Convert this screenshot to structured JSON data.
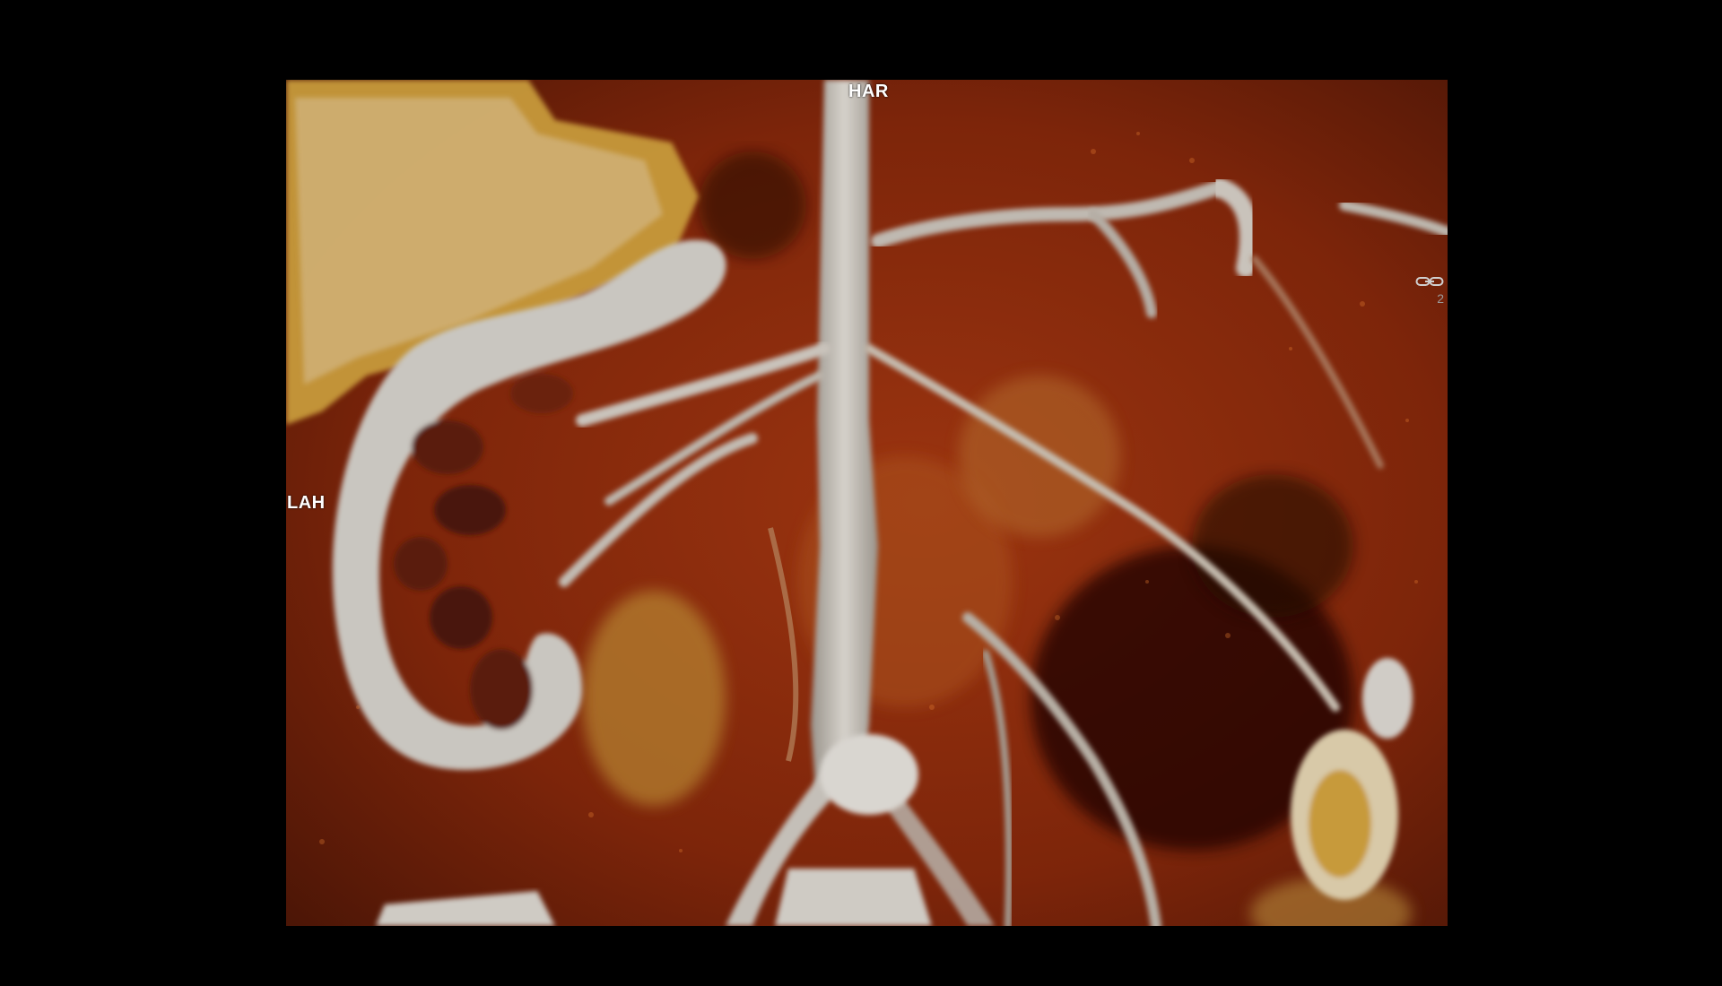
{
  "viewer": {
    "orientation": {
      "top": "HAR",
      "left": "LAH"
    },
    "link_control": {
      "icon": "link-icon",
      "value": "2"
    }
  },
  "colors": {
    "background": "#000000",
    "tissue": "#8a2a0c",
    "vessel": "#c8c4bc",
    "fat": "#c79a3a",
    "label": "#ffffff"
  }
}
